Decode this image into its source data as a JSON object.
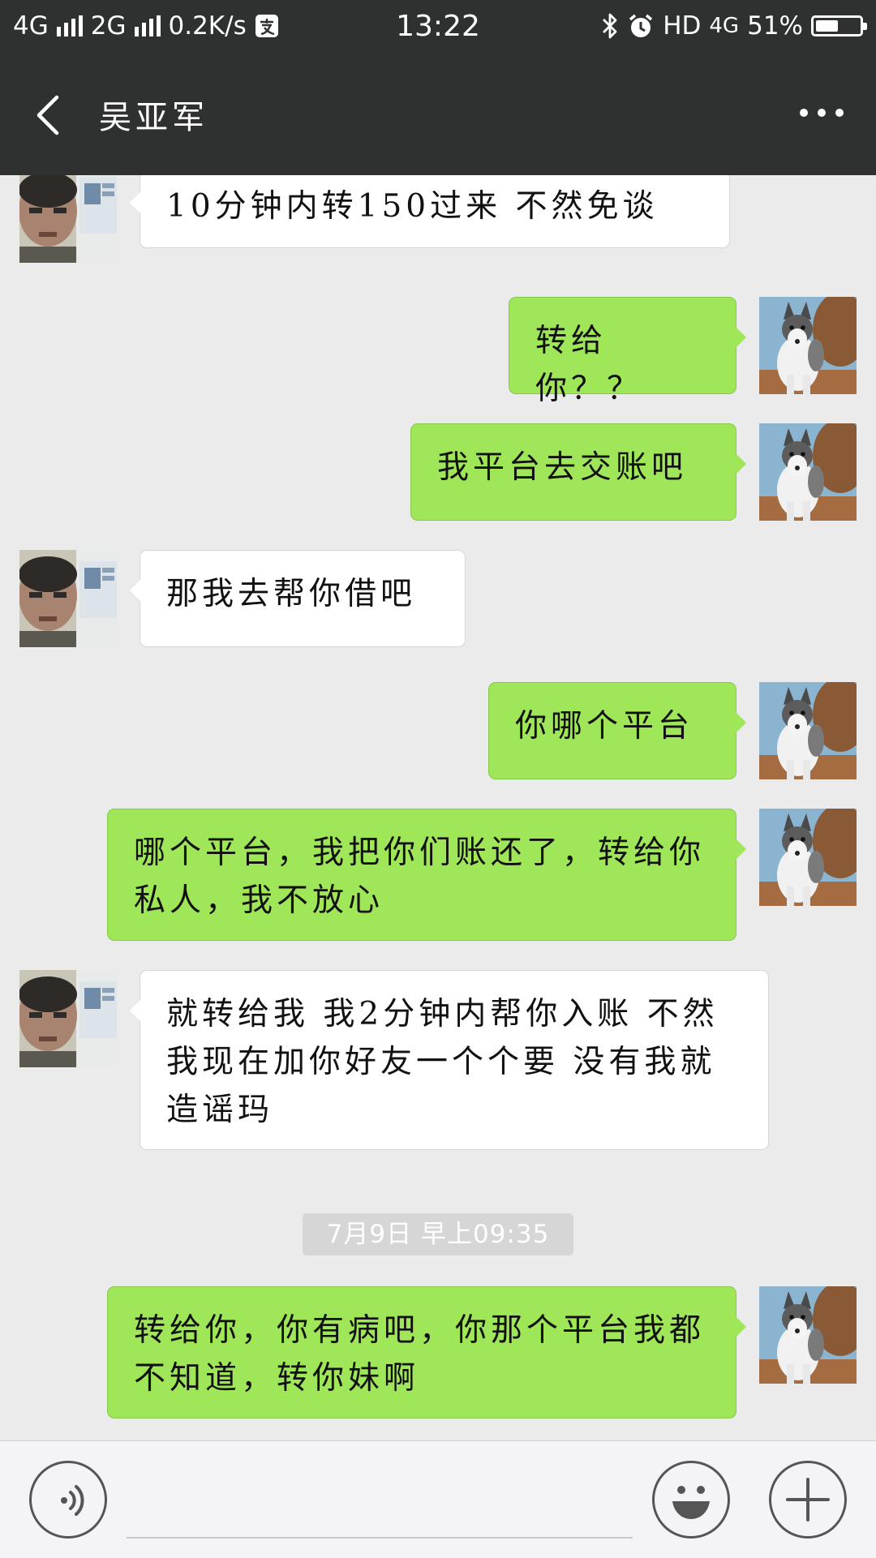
{
  "status_bar": {
    "network1": "4G",
    "network2": "2G",
    "speed": "0.2K/s",
    "time": "13:22",
    "hd": "HD",
    "network3": "4G",
    "battery": "51%",
    "battery_level": 0.51
  },
  "header": {
    "title": "吴亚军"
  },
  "messages": [
    {
      "side": "in",
      "text": "10分钟内转150过来 不然免谈"
    },
    {
      "side": "out",
      "text": "转给你？？"
    },
    {
      "side": "out",
      "text": "我平台去交账吧"
    },
    {
      "side": "in",
      "text": "那我去帮你借吧"
    },
    {
      "side": "out",
      "text": "你哪个平台"
    },
    {
      "side": "out",
      "text": "哪个平台，我把你们账还了，转给你私人，我不放心"
    },
    {
      "side": "in",
      "text": "就转给我 我2分钟内帮你入账 不然我现在加你好友一个个要 没有我就造谣玛"
    },
    {
      "side": "out",
      "text": "转给你，你有病吧，你那个平台我都不知道，转你妹啊"
    }
  ],
  "timestamp": "7月9日 早上09:35",
  "icons": {
    "back": "chevron-left-icon",
    "more": "more-dots-icon",
    "voice": "voice-icon",
    "emoji": "emoji-icon",
    "plus": "plus-icon"
  },
  "colors": {
    "bar_bg": "#2f3030",
    "chat_bg": "#ebebeb",
    "out_bubble": "#9fe658",
    "in_bubble": "#ffffff"
  }
}
